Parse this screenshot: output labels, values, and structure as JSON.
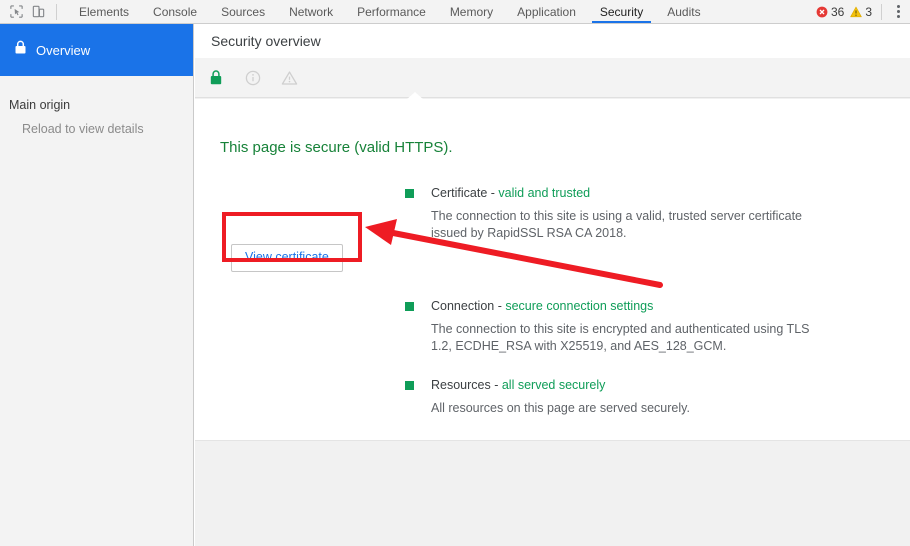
{
  "toolbar": {
    "icons": [
      {
        "name": "inspect-element-icon",
        "label": "Inspect element"
      },
      {
        "name": "device-toolbar-icon",
        "label": "Toggle device toolbar"
      }
    ],
    "tabs": [
      {
        "label": "Elements",
        "selected": false
      },
      {
        "label": "Console",
        "selected": false
      },
      {
        "label": "Sources",
        "selected": false
      },
      {
        "label": "Network",
        "selected": false
      },
      {
        "label": "Performance",
        "selected": false
      },
      {
        "label": "Memory",
        "selected": false
      },
      {
        "label": "Application",
        "selected": false
      },
      {
        "label": "Security",
        "selected": true
      },
      {
        "label": "Audits",
        "selected": false
      }
    ],
    "errors": {
      "icon": "error-icon",
      "count": "36",
      "color": "#e53935"
    },
    "warnings": {
      "icon": "warning-icon",
      "count": "3",
      "color": "#f4b400"
    },
    "menu": {
      "icon": "more-vertical-icon",
      "label": "Customize and control DevTools"
    },
    "selected_underline_color": "#1a73e8"
  },
  "sidebar": {
    "overview": {
      "label": "Overview",
      "icon": "lock-icon",
      "selected": true,
      "bg_color": "#1a73e8"
    },
    "group_title": "Main origin",
    "group_note": "Reload to view details"
  },
  "main": {
    "panel_title": "Security overview",
    "summary_icons": [
      {
        "name": "lock-icon",
        "state": "active",
        "color": "#0f9d58"
      },
      {
        "name": "info-circle-icon",
        "state": "disabled",
        "color": "#cdcdcd"
      },
      {
        "name": "warning-triangle-icon",
        "state": "disabled",
        "color": "#cdcdcd"
      }
    ],
    "headline": "This page is secure (valid HTTPS).",
    "headline_color": "#178239",
    "sections": [
      {
        "title": "Certificate - ",
        "status": "valid and trusted",
        "status_color": "#0f9d58",
        "bullet_color": "#0f9d58",
        "body": "The connection to this site is using a valid, trusted server certificate issued by RapidSSL RSA CA 2018."
      },
      {
        "title": "Connection - ",
        "status": "secure connection settings",
        "status_color": "#0f9d58",
        "bullet_color": "#0f9d58",
        "body": "The connection to this site is encrypted and authenticated using TLS 1.2, ECDHE_RSA with X25519, and AES_128_GCM."
      },
      {
        "title": "Resources - ",
        "status": "all served securely",
        "status_color": "#0f9d58",
        "bullet_color": "#0f9d58",
        "body": "All resources on this page are served securely."
      }
    ],
    "view_certificate_button": "View certificate"
  },
  "annotations": {
    "highlight_color": "#ee1c24",
    "box_target": "view-certificate-button",
    "arrow_direction": "up-left"
  }
}
